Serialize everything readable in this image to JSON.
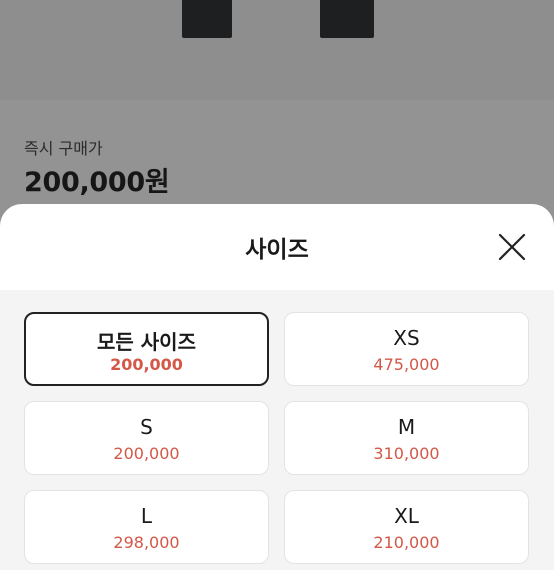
{
  "instant_buy": {
    "label": "즉시 구매가",
    "price": "200,000원"
  },
  "sheet": {
    "title": "사이즈",
    "close_icon": "close-icon",
    "sizes": [
      {
        "name": "모든 사이즈",
        "price": "200,000",
        "selected": true
      },
      {
        "name": "XS",
        "price": "475,000",
        "selected": false
      },
      {
        "name": "S",
        "price": "200,000",
        "selected": false
      },
      {
        "name": "M",
        "price": "310,000",
        "selected": false
      },
      {
        "name": "L",
        "price": "298,000",
        "selected": false
      },
      {
        "name": "XL",
        "price": "210,000",
        "selected": false
      }
    ]
  },
  "colors": {
    "price_accent": "#d45748",
    "overlay": "#8c8c8c"
  }
}
